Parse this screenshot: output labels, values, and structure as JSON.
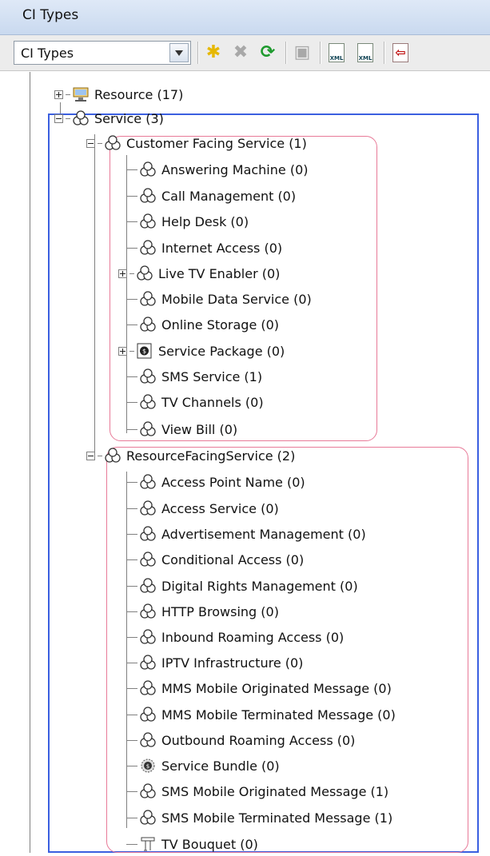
{
  "panel": {
    "title": "CI Types"
  },
  "toolbar": {
    "selector_value": "CI Types",
    "buttons": [
      {
        "name": "new-icon",
        "glyph": "✱",
        "color": "#e6b800"
      },
      {
        "name": "delete-icon",
        "glyph": "✖",
        "color": "#a8a8a8"
      },
      {
        "name": "refresh-icon",
        "glyph": "⟳",
        "color": "#1e9a2e"
      },
      {
        "name": "save-icon",
        "glyph": "▣",
        "color": "#a8a8a8"
      },
      {
        "name": "export-xml-icon",
        "glyph": "XML",
        "color": "#1a6a2a"
      },
      {
        "name": "import-xml-icon",
        "glyph": "XML",
        "color": "#1a6a2a"
      },
      {
        "name": "export-pdf-icon",
        "glyph": "⇦",
        "color": "#c01010"
      }
    ]
  },
  "tree": [
    {
      "label": "Resource (17)",
      "icon": "resource-icon",
      "level": 0,
      "expander": "plus"
    },
    {
      "label": "Service (3)",
      "icon": "service-icon",
      "level": 0,
      "expander": "minus"
    },
    {
      "label": "Customer Facing Service (1)",
      "icon": "service-icon",
      "level": 1,
      "expander": "minus"
    },
    {
      "label": "Answering Machine (0)",
      "icon": "service-icon",
      "level": 2
    },
    {
      "label": "Call Management (0)",
      "icon": "service-icon",
      "level": 2
    },
    {
      "label": "Help Desk (0)",
      "icon": "service-icon",
      "level": 2
    },
    {
      "label": "Internet Access (0)",
      "icon": "service-icon",
      "level": 2
    },
    {
      "label": "Live TV Enabler (0)",
      "icon": "service-icon",
      "level": 2,
      "expander": "plus"
    },
    {
      "label": "Mobile Data Service (0)",
      "icon": "service-icon",
      "level": 2
    },
    {
      "label": "Online Storage (0)",
      "icon": "service-icon",
      "level": 2
    },
    {
      "label": "Service Package (0)",
      "icon": "service-package-icon",
      "level": 2,
      "expander": "plus"
    },
    {
      "label": "SMS Service (1)",
      "icon": "service-icon",
      "level": 2
    },
    {
      "label": "TV Channels (0)",
      "icon": "service-icon",
      "level": 2
    },
    {
      "label": "View Bill (0)",
      "icon": "service-icon",
      "level": 2
    },
    {
      "label": "ResourceFacingService (2)",
      "icon": "service-icon",
      "level": 1,
      "expander": "minus"
    },
    {
      "label": "Access Point Name (0)",
      "icon": "service-icon",
      "level": 2
    },
    {
      "label": "Access Service (0)",
      "icon": "service-icon",
      "level": 2
    },
    {
      "label": "Advertisement Management (0)",
      "icon": "service-icon",
      "level": 2
    },
    {
      "label": "Conditional Access (0)",
      "icon": "service-icon",
      "level": 2
    },
    {
      "label": "Digital Rights Management (0)",
      "icon": "service-icon",
      "level": 2
    },
    {
      "label": "HTTP Browsing (0)",
      "icon": "service-icon",
      "level": 2
    },
    {
      "label": "Inbound Roaming Access (0)",
      "icon": "service-icon",
      "level": 2
    },
    {
      "label": "IPTV Infrastructure (0)",
      "icon": "service-icon",
      "level": 2
    },
    {
      "label": "MMS Mobile Originated Message (0)",
      "icon": "service-icon",
      "level": 2
    },
    {
      "label": "MMS Mobile Terminated Message (0)",
      "icon": "service-icon",
      "level": 2
    },
    {
      "label": "Outbound Roaming Access (0)",
      "icon": "service-icon",
      "level": 2
    },
    {
      "label": "Service Bundle (0)",
      "icon": "service-bundle-icon",
      "level": 2
    },
    {
      "label": "SMS Mobile Originated Message (1)",
      "icon": "service-icon",
      "level": 2
    },
    {
      "label": "SMS Mobile Terminated Message (1)",
      "icon": "service-icon",
      "level": 2
    },
    {
      "label": "TV Bouquet (0)",
      "icon": "tv-bouquet-icon",
      "level": 2
    }
  ]
}
